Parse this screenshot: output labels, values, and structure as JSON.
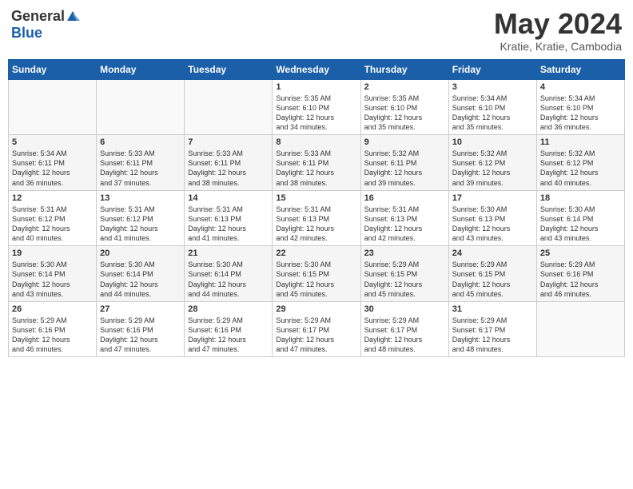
{
  "header": {
    "logo_general": "General",
    "logo_blue": "Blue",
    "month_title": "May 2024",
    "location": "Kratie, Kratie, Cambodia"
  },
  "calendar": {
    "days_of_week": [
      "Sunday",
      "Monday",
      "Tuesday",
      "Wednesday",
      "Thursday",
      "Friday",
      "Saturday"
    ],
    "weeks": [
      [
        {
          "day": "",
          "info": ""
        },
        {
          "day": "",
          "info": ""
        },
        {
          "day": "",
          "info": ""
        },
        {
          "day": "1",
          "info": "Sunrise: 5:35 AM\nSunset: 6:10 PM\nDaylight: 12 hours\nand 34 minutes."
        },
        {
          "day": "2",
          "info": "Sunrise: 5:35 AM\nSunset: 6:10 PM\nDaylight: 12 hours\nand 35 minutes."
        },
        {
          "day": "3",
          "info": "Sunrise: 5:34 AM\nSunset: 6:10 PM\nDaylight: 12 hours\nand 35 minutes."
        },
        {
          "day": "4",
          "info": "Sunrise: 5:34 AM\nSunset: 6:10 PM\nDaylight: 12 hours\nand 36 minutes."
        }
      ],
      [
        {
          "day": "5",
          "info": "Sunrise: 5:34 AM\nSunset: 6:11 PM\nDaylight: 12 hours\nand 36 minutes."
        },
        {
          "day": "6",
          "info": "Sunrise: 5:33 AM\nSunset: 6:11 PM\nDaylight: 12 hours\nand 37 minutes."
        },
        {
          "day": "7",
          "info": "Sunrise: 5:33 AM\nSunset: 6:11 PM\nDaylight: 12 hours\nand 38 minutes."
        },
        {
          "day": "8",
          "info": "Sunrise: 5:33 AM\nSunset: 6:11 PM\nDaylight: 12 hours\nand 38 minutes."
        },
        {
          "day": "9",
          "info": "Sunrise: 5:32 AM\nSunset: 6:11 PM\nDaylight: 12 hours\nand 39 minutes."
        },
        {
          "day": "10",
          "info": "Sunrise: 5:32 AM\nSunset: 6:12 PM\nDaylight: 12 hours\nand 39 minutes."
        },
        {
          "day": "11",
          "info": "Sunrise: 5:32 AM\nSunset: 6:12 PM\nDaylight: 12 hours\nand 40 minutes."
        }
      ],
      [
        {
          "day": "12",
          "info": "Sunrise: 5:31 AM\nSunset: 6:12 PM\nDaylight: 12 hours\nand 40 minutes."
        },
        {
          "day": "13",
          "info": "Sunrise: 5:31 AM\nSunset: 6:12 PM\nDaylight: 12 hours\nand 41 minutes."
        },
        {
          "day": "14",
          "info": "Sunrise: 5:31 AM\nSunset: 6:13 PM\nDaylight: 12 hours\nand 41 minutes."
        },
        {
          "day": "15",
          "info": "Sunrise: 5:31 AM\nSunset: 6:13 PM\nDaylight: 12 hours\nand 42 minutes."
        },
        {
          "day": "16",
          "info": "Sunrise: 5:31 AM\nSunset: 6:13 PM\nDaylight: 12 hours\nand 42 minutes."
        },
        {
          "day": "17",
          "info": "Sunrise: 5:30 AM\nSunset: 6:13 PM\nDaylight: 12 hours\nand 43 minutes."
        },
        {
          "day": "18",
          "info": "Sunrise: 5:30 AM\nSunset: 6:14 PM\nDaylight: 12 hours\nand 43 minutes."
        }
      ],
      [
        {
          "day": "19",
          "info": "Sunrise: 5:30 AM\nSunset: 6:14 PM\nDaylight: 12 hours\nand 43 minutes."
        },
        {
          "day": "20",
          "info": "Sunrise: 5:30 AM\nSunset: 6:14 PM\nDaylight: 12 hours\nand 44 minutes."
        },
        {
          "day": "21",
          "info": "Sunrise: 5:30 AM\nSunset: 6:14 PM\nDaylight: 12 hours\nand 44 minutes."
        },
        {
          "day": "22",
          "info": "Sunrise: 5:30 AM\nSunset: 6:15 PM\nDaylight: 12 hours\nand 45 minutes."
        },
        {
          "day": "23",
          "info": "Sunrise: 5:29 AM\nSunset: 6:15 PM\nDaylight: 12 hours\nand 45 minutes."
        },
        {
          "day": "24",
          "info": "Sunrise: 5:29 AM\nSunset: 6:15 PM\nDaylight: 12 hours\nand 45 minutes."
        },
        {
          "day": "25",
          "info": "Sunrise: 5:29 AM\nSunset: 6:16 PM\nDaylight: 12 hours\nand 46 minutes."
        }
      ],
      [
        {
          "day": "26",
          "info": "Sunrise: 5:29 AM\nSunset: 6:16 PM\nDaylight: 12 hours\nand 46 minutes."
        },
        {
          "day": "27",
          "info": "Sunrise: 5:29 AM\nSunset: 6:16 PM\nDaylight: 12 hours\nand 47 minutes."
        },
        {
          "day": "28",
          "info": "Sunrise: 5:29 AM\nSunset: 6:16 PM\nDaylight: 12 hours\nand 47 minutes."
        },
        {
          "day": "29",
          "info": "Sunrise: 5:29 AM\nSunset: 6:17 PM\nDaylight: 12 hours\nand 47 minutes."
        },
        {
          "day": "30",
          "info": "Sunrise: 5:29 AM\nSunset: 6:17 PM\nDaylight: 12 hours\nand 48 minutes."
        },
        {
          "day": "31",
          "info": "Sunrise: 5:29 AM\nSunset: 6:17 PM\nDaylight: 12 hours\nand 48 minutes."
        },
        {
          "day": "",
          "info": ""
        }
      ]
    ]
  }
}
